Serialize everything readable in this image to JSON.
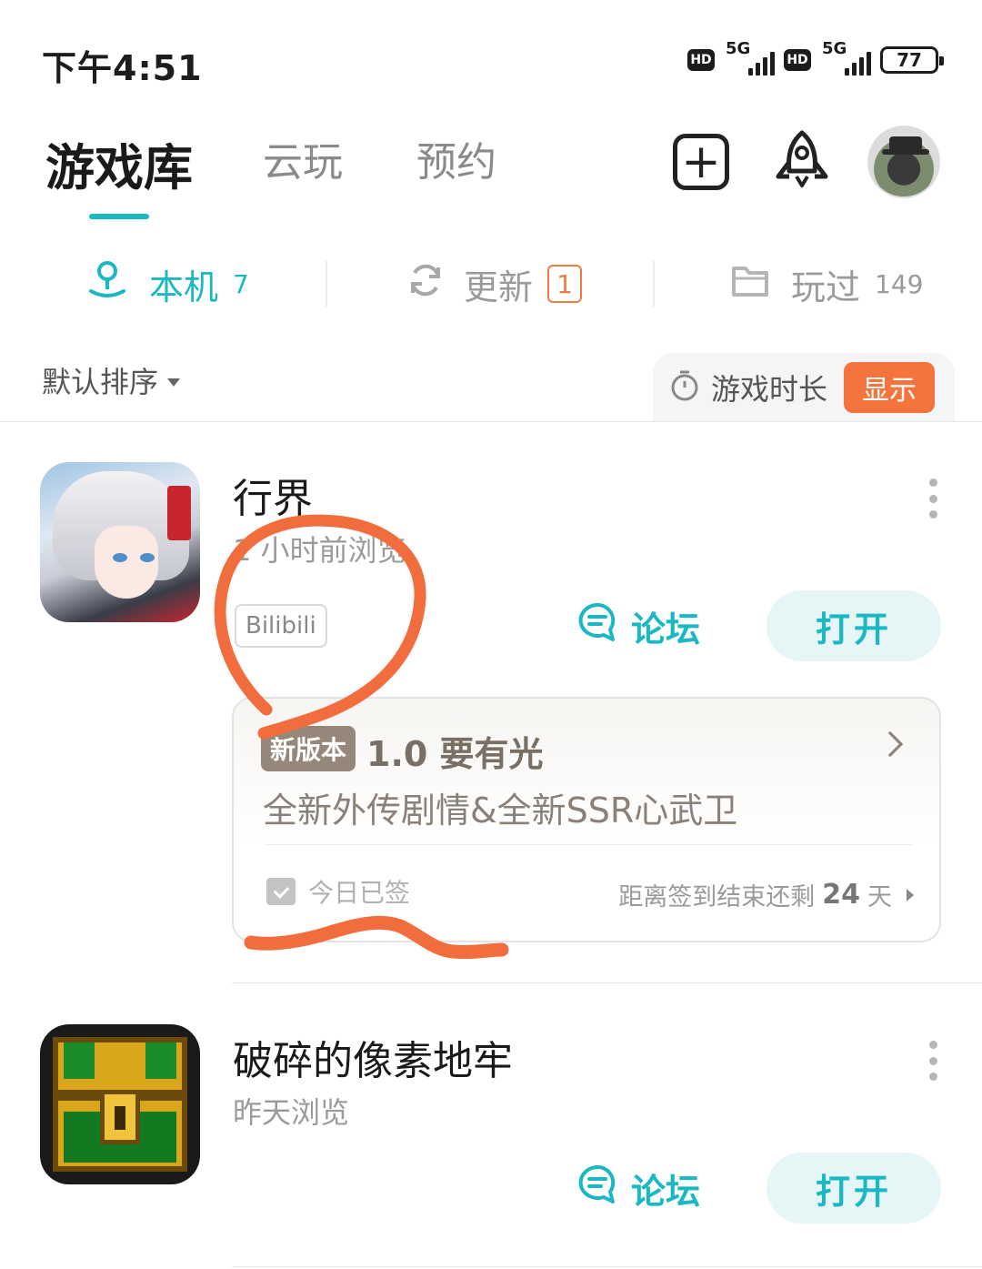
{
  "status_bar": {
    "time": "下午4:51",
    "hd_label": "HD",
    "network": "5G",
    "battery": "77"
  },
  "header": {
    "tabs": [
      {
        "label": "游戏库",
        "active": true
      },
      {
        "label": "云玩",
        "active": false
      },
      {
        "label": "预约",
        "active": false
      }
    ],
    "icons": [
      "add-icon",
      "rocket-icon",
      "avatar"
    ]
  },
  "sub_tabs": [
    {
      "label": "本机",
      "count": "7",
      "icon": "location-pin-icon",
      "active": true
    },
    {
      "label": "更新",
      "badge": "1",
      "icon": "refresh-icon",
      "active": false
    },
    {
      "label": "玩过",
      "count": "149",
      "icon": "folder-icon",
      "active": false
    }
  ],
  "sort": {
    "label": "默认排序",
    "playtime_label": "游戏时长",
    "show_label": "显示"
  },
  "games": [
    {
      "title": "行界",
      "subtitle": "1 小时前浏览",
      "tag": "Bilibili",
      "forum_label": "论坛",
      "open_label": "打开",
      "version": {
        "badge": "新版本",
        "title": "1.0 要有光",
        "desc": "全新外传剧情&全新SSR心武卫",
        "checkin": "今日已签",
        "remain_prefix": "距离签到结束还剩",
        "remain_days": "24",
        "remain_suffix": "天"
      }
    },
    {
      "title": "破碎的像素地牢",
      "subtitle": "昨天浏览",
      "forum_label": "论坛",
      "open_label": "打开"
    }
  ],
  "colors": {
    "accent": "#1ab8c2",
    "orange": "#f5733d",
    "annotation": "#f26d3d"
  }
}
